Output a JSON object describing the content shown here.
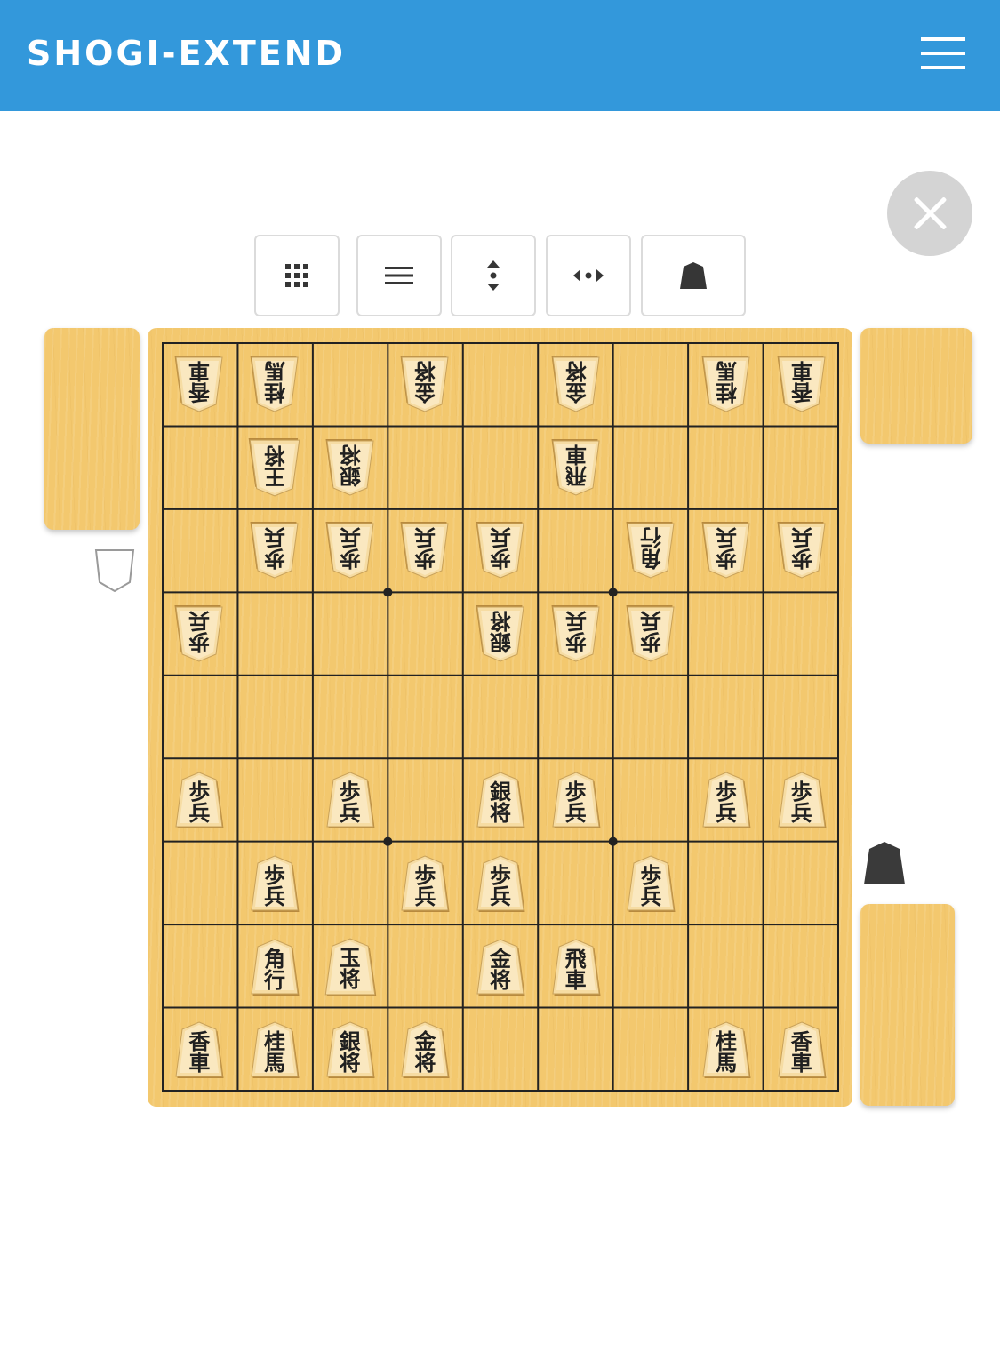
{
  "header": {
    "brand": "SHOGI-EXTEND",
    "menu_icon": "hamburger-menu-icon",
    "background": "#3398db"
  },
  "toolbar": {
    "buttons": [
      {
        "name": "grid-view-button",
        "icon": "grid-3x3-icon"
      },
      {
        "name": "list-menu-button",
        "icon": "list-lines-icon"
      },
      {
        "name": "flip-vertical-button",
        "icon": "updown-arrows-icon"
      },
      {
        "name": "flip-horizontal-button",
        "icon": "leftright-arrows-icon"
      },
      {
        "name": "piece-style-button",
        "icon": "shogi-piece-icon"
      }
    ]
  },
  "close_button": {
    "icon": "close-x-icon"
  },
  "board": {
    "files": 9,
    "ranks": 9,
    "wood_color": "#f3c86e",
    "pieces": [
      {
        "file": 9,
        "rank": 1,
        "side": "gote",
        "top": "香",
        "bottom": "車"
      },
      {
        "file": 8,
        "rank": 1,
        "side": "gote",
        "top": "桂",
        "bottom": "馬"
      },
      {
        "file": 6,
        "rank": 1,
        "side": "gote",
        "top": "金",
        "bottom": "将"
      },
      {
        "file": 4,
        "rank": 1,
        "side": "gote",
        "top": "金",
        "bottom": "将"
      },
      {
        "file": 2,
        "rank": 1,
        "side": "gote",
        "top": "桂",
        "bottom": "馬"
      },
      {
        "file": 1,
        "rank": 1,
        "side": "gote",
        "top": "香",
        "bottom": "車"
      },
      {
        "file": 8,
        "rank": 2,
        "side": "gote",
        "top": "王",
        "bottom": "将",
        "king": true
      },
      {
        "file": 7,
        "rank": 2,
        "side": "gote",
        "top": "銀",
        "bottom": "将"
      },
      {
        "file": 4,
        "rank": 2,
        "side": "gote",
        "top": "飛",
        "bottom": "車"
      },
      {
        "file": 8,
        "rank": 3,
        "side": "gote",
        "top": "歩",
        "bottom": "兵"
      },
      {
        "file": 7,
        "rank": 3,
        "side": "gote",
        "top": "歩",
        "bottom": "兵"
      },
      {
        "file": 6,
        "rank": 3,
        "side": "gote",
        "top": "歩",
        "bottom": "兵"
      },
      {
        "file": 5,
        "rank": 3,
        "side": "gote",
        "top": "歩",
        "bottom": "兵"
      },
      {
        "file": 3,
        "rank": 3,
        "side": "gote",
        "top": "角",
        "bottom": "行"
      },
      {
        "file": 2,
        "rank": 3,
        "side": "gote",
        "top": "歩",
        "bottom": "兵"
      },
      {
        "file": 1,
        "rank": 3,
        "side": "gote",
        "top": "歩",
        "bottom": "兵"
      },
      {
        "file": 9,
        "rank": 4,
        "side": "gote",
        "top": "歩",
        "bottom": "兵"
      },
      {
        "file": 5,
        "rank": 4,
        "side": "gote",
        "top": "銀",
        "bottom": "将"
      },
      {
        "file": 4,
        "rank": 4,
        "side": "gote",
        "top": "歩",
        "bottom": "兵"
      },
      {
        "file": 3,
        "rank": 4,
        "side": "gote",
        "top": "歩",
        "bottom": "兵"
      },
      {
        "file": 9,
        "rank": 6,
        "side": "sente",
        "top": "歩",
        "bottom": "兵"
      },
      {
        "file": 7,
        "rank": 6,
        "side": "sente",
        "top": "歩",
        "bottom": "兵"
      },
      {
        "file": 5,
        "rank": 6,
        "side": "sente",
        "top": "銀",
        "bottom": "将"
      },
      {
        "file": 4,
        "rank": 6,
        "side": "sente",
        "top": "歩",
        "bottom": "兵"
      },
      {
        "file": 2,
        "rank": 6,
        "side": "sente",
        "top": "歩",
        "bottom": "兵"
      },
      {
        "file": 1,
        "rank": 6,
        "side": "sente",
        "top": "歩",
        "bottom": "兵"
      },
      {
        "file": 8,
        "rank": 7,
        "side": "sente",
        "top": "歩",
        "bottom": "兵"
      },
      {
        "file": 6,
        "rank": 7,
        "side": "sente",
        "top": "歩",
        "bottom": "兵"
      },
      {
        "file": 5,
        "rank": 7,
        "side": "sente",
        "top": "歩",
        "bottom": "兵"
      },
      {
        "file": 3,
        "rank": 7,
        "side": "sente",
        "top": "歩",
        "bottom": "兵"
      },
      {
        "file": 8,
        "rank": 8,
        "side": "sente",
        "top": "角",
        "bottom": "行"
      },
      {
        "file": 7,
        "rank": 8,
        "side": "sente",
        "top": "玉",
        "bottom": "将",
        "king": true
      },
      {
        "file": 5,
        "rank": 8,
        "side": "sente",
        "top": "金",
        "bottom": "将"
      },
      {
        "file": 4,
        "rank": 8,
        "side": "sente",
        "top": "飛",
        "bottom": "車"
      },
      {
        "file": 9,
        "rank": 9,
        "side": "sente",
        "top": "香",
        "bottom": "車"
      },
      {
        "file": 8,
        "rank": 9,
        "side": "sente",
        "top": "桂",
        "bottom": "馬"
      },
      {
        "file": 7,
        "rank": 9,
        "side": "sente",
        "top": "銀",
        "bottom": "将"
      },
      {
        "file": 6,
        "rank": 9,
        "side": "sente",
        "top": "金",
        "bottom": "将"
      },
      {
        "file": 2,
        "rank": 9,
        "side": "sente",
        "top": "桂",
        "bottom": "馬"
      },
      {
        "file": 1,
        "rank": 9,
        "side": "sente",
        "top": "香",
        "bottom": "車"
      }
    ]
  },
  "hands": {
    "gote": {
      "pieces": []
    },
    "sente": {
      "pieces": []
    }
  },
  "turn_indicator": {
    "side": "sente",
    "color": "#3a3a3a"
  }
}
